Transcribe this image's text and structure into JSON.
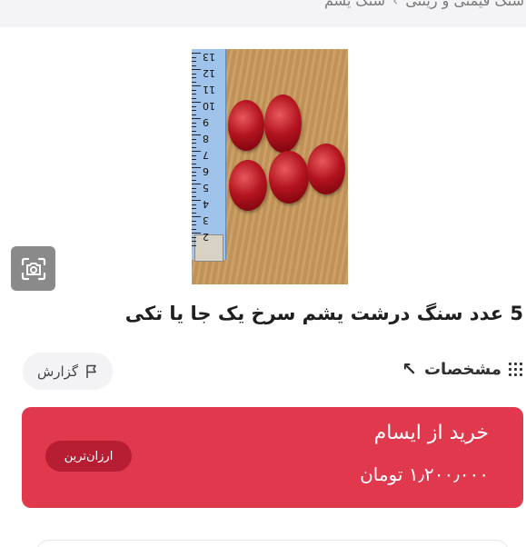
{
  "breadcrumb": {
    "items": [
      "سنگ قیمتی و زینتی",
      "سنگ یشم"
    ],
    "separator": "›"
  },
  "listing": {
    "title": "5 عدد سنگ درشت یشم سرخ یک جا یا تکی"
  },
  "tape_numbers": [
    "13",
    "12",
    "11",
    "10",
    "9",
    "8",
    "7",
    "6",
    "5",
    "4",
    "3",
    "2"
  ],
  "actions": {
    "specs_label": "مشخصات",
    "report_label": "گزارش"
  },
  "purchase": {
    "seller_label": "خرید از ایسام",
    "price": "۱٫۲۰۰٫۰۰۰ تومان",
    "badge": "ارزان‌ترین"
  },
  "colors": {
    "buy_background": "#e0394e",
    "badge_background": "#b71e34",
    "lens_button": "#8a8a8a"
  },
  "icons": {
    "lens": "camera-search-icon",
    "specs": "grid-dots-icon",
    "expand": "arrow-up-left-icon",
    "report": "flag-icon"
  }
}
